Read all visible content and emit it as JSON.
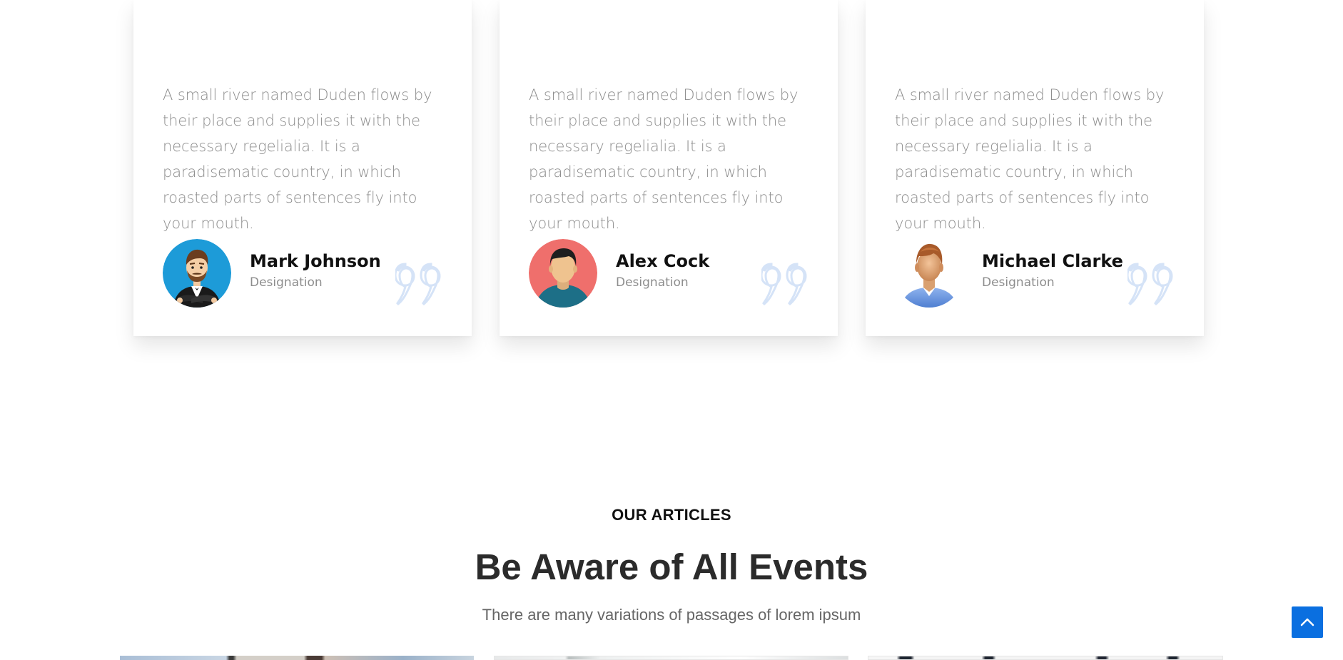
{
  "testimonials": [
    {
      "text": "A small river named Duden flows by their place and supplies it with the necessary regelialia. It is a paradisematic country, in which roasted parts of sentences fly into your mouth.",
      "name": "Mark Johnson",
      "role": "Designation",
      "avatar_icon": "businessman-cartoon-avatar-icon"
    },
    {
      "text": "A small river named Duden flows by their place and supplies it with the necessary regelialia. It is a paradisematic country, in which roasted parts of sentences fly into your mouth.",
      "name": "Alex Cock",
      "role": "Designation",
      "avatar_icon": "man-flat-avatar-icon"
    },
    {
      "text": "A small river named Duden flows by their place and supplies it with the necessary regelialia. It is a paradisematic country, in which roasted parts of sentences fly into your mouth.",
      "name": "Michael Clarke",
      "role": "Designation",
      "avatar_icon": "man-3d-avatar-icon"
    }
  ],
  "articles": {
    "kicker": "OUR ARTICLES",
    "title": "Be Aware of All Events",
    "subtitle": "There are many variations of passages of lorem ipsum"
  },
  "back_to_top_icon": "chevron-up-icon",
  "colors": {
    "accent": "#0a6fe0",
    "quote_icon": "#d5e3f7",
    "body_text": "#8d8d8d",
    "avatar_blue": "#1d9bd8",
    "avatar_red": "#ef6f6c"
  }
}
